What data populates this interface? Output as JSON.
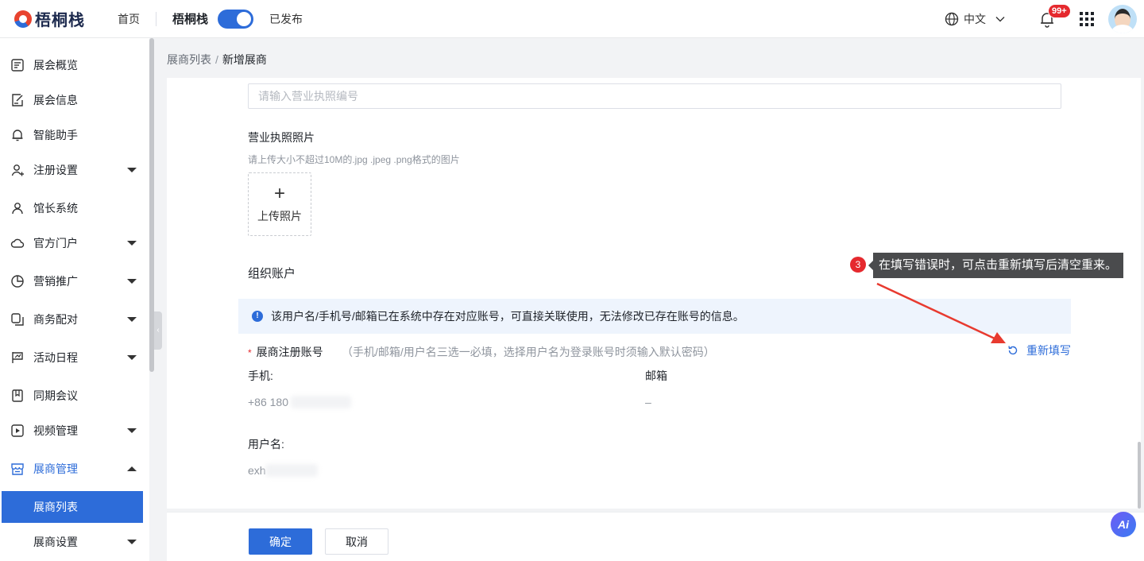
{
  "header": {
    "logo_text": "梧桐栈",
    "home": "首页",
    "site_name": "梧桐栈",
    "publish_status": "已发布",
    "language": "中文",
    "notification_count": "99+",
    "colors": {
      "accent": "#2d6cd9",
      "badge": "#e5292e"
    }
  },
  "sidebar": {
    "items": [
      {
        "label": "展会概览",
        "icon": "dashboard-icon"
      },
      {
        "label": "展会信息",
        "icon": "edit-doc-icon"
      },
      {
        "label": "智能助手",
        "icon": "bell-icon"
      },
      {
        "label": "注册设置",
        "icon": "user-add-icon"
      },
      {
        "label": "馆长系统",
        "icon": "user-icon"
      },
      {
        "label": "官方门户",
        "icon": "cloud-icon"
      },
      {
        "label": "营销推广",
        "icon": "pie-chart-icon"
      },
      {
        "label": "商务配对",
        "icon": "copy-icon"
      },
      {
        "label": "活动日程",
        "icon": "flag-icon"
      },
      {
        "label": "同期会议",
        "icon": "bookmark-icon"
      },
      {
        "label": "视频管理",
        "icon": "video-icon"
      },
      {
        "label": "展商管理",
        "icon": "store-icon"
      }
    ],
    "sub_items": [
      {
        "label": "展商列表"
      },
      {
        "label": "展商设置"
      }
    ]
  },
  "breadcrumb": {
    "parent": "展商列表",
    "separator": "/",
    "current": "新增展商"
  },
  "form": {
    "license_placeholder": "请输入营业执照编号",
    "license_photo_title": "营业执照照片",
    "license_photo_hint": "请上传大小不超过10M的.jpg .jpeg .png格式的图片",
    "upload_plus": "+",
    "upload_label": "上传照片",
    "org_account_title": "组织账户",
    "alert_icon": "!",
    "alert_text": "该用户名/手机号/邮箱已在系统中存在对应账号，可直接关联使用，无法修改已存在账号的信息。",
    "account_required_mark": "*",
    "account_label": "展商注册账号",
    "account_note": "（手机/邮箱/用户名三选一必填，选择用户名为登录账号时须输入默认密码）",
    "reset_label": "重新填写",
    "phone_label": "手机:",
    "phone_value": "+86 180",
    "email_label": "邮箱",
    "email_value": "–",
    "username_label": "用户名:",
    "username_value": "exh"
  },
  "footer": {
    "ok_label": "确定",
    "cancel_label": "取消"
  },
  "ai_button": "Ai",
  "annotation": {
    "step": "3",
    "text": "在填写错误时，可点击重新填写后清空重来。"
  }
}
